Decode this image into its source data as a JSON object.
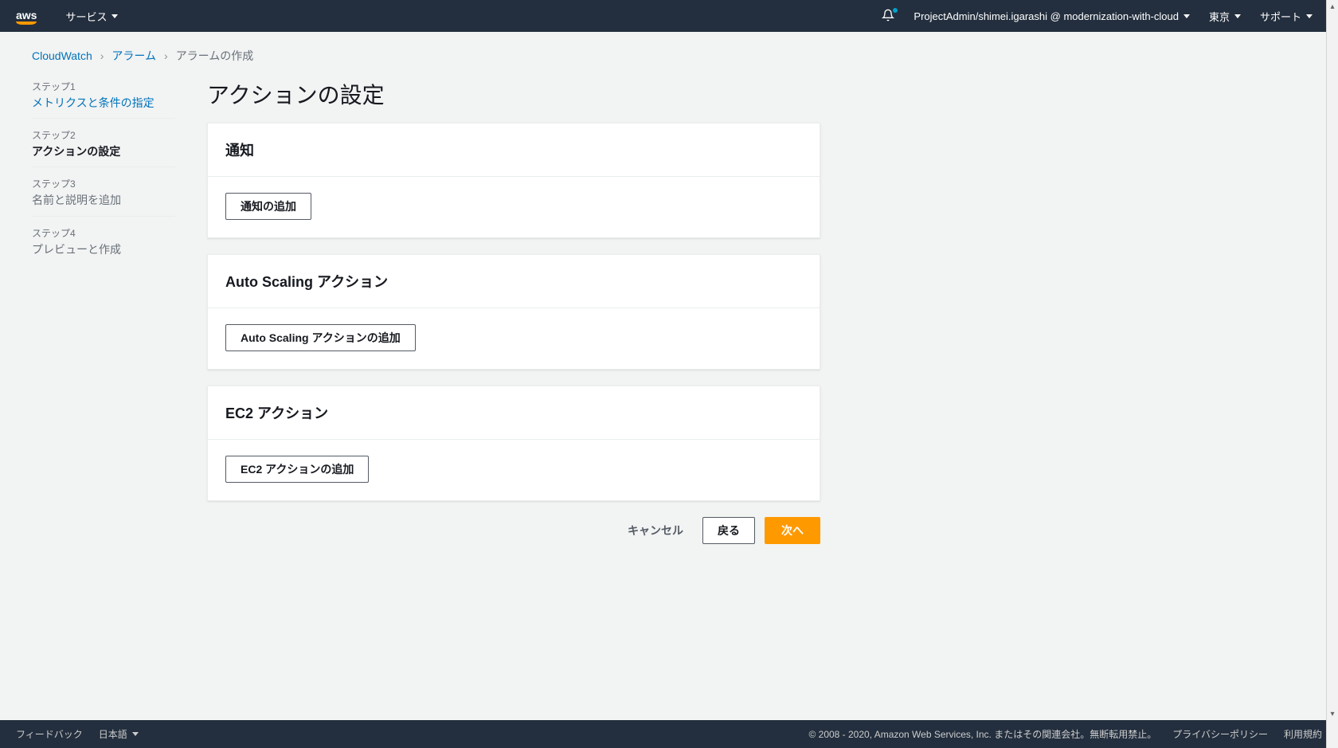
{
  "topnav": {
    "services_label": "サービス",
    "account_label": "ProjectAdmin/shimei.igarashi @ modernization-with-cloud",
    "region_label": "東京",
    "support_label": "サポート"
  },
  "breadcrumbs": {
    "cloudwatch": "CloudWatch",
    "alarms": "アラーム",
    "create": "アラームの作成"
  },
  "steps": [
    {
      "label": "ステップ1",
      "title": "メトリクスと条件の指定",
      "state": "done"
    },
    {
      "label": "ステップ2",
      "title": "アクションの設定",
      "state": "active"
    },
    {
      "label": "ステップ3",
      "title": "名前と説明を追加",
      "state": "pending"
    },
    {
      "label": "ステップ4",
      "title": "プレビューと作成",
      "state": "pending"
    }
  ],
  "page": {
    "title": "アクションの設定"
  },
  "panels": {
    "notify": {
      "title": "通知",
      "add_btn": "通知の追加"
    },
    "autoscaling": {
      "title": "Auto Scaling アクション",
      "add_btn": "Auto Scaling アクションの追加"
    },
    "ec2": {
      "title": "EC2 アクション",
      "add_btn": "EC2 アクションの追加"
    }
  },
  "wizard_buttons": {
    "cancel": "キャンセル",
    "back": "戻る",
    "next": "次へ"
  },
  "footer": {
    "feedback": "フィードバック",
    "language": "日本語",
    "copyright": "© 2008 - 2020, Amazon Web Services, Inc. またはその関連会社。無断転用禁止。",
    "privacy": "プライバシーポリシー",
    "terms": "利用規約"
  }
}
